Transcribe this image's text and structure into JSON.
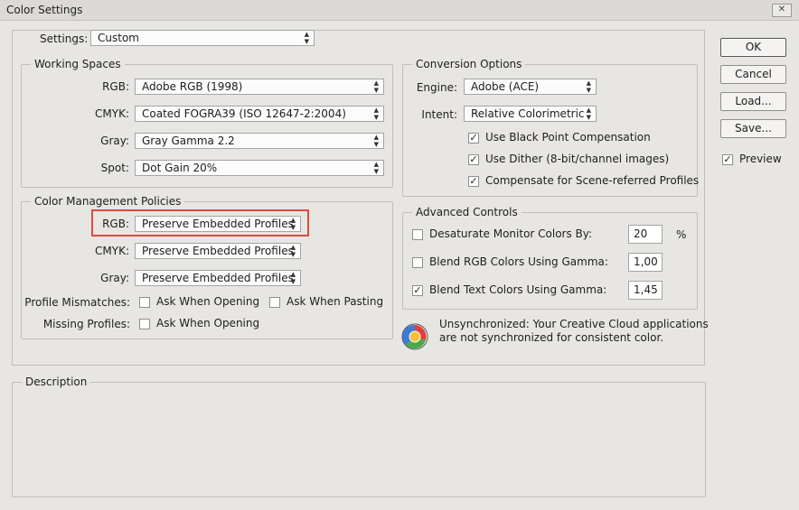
{
  "window": {
    "title": "Color Settings",
    "close_glyph": "✕"
  },
  "settings": {
    "label": "Settings:",
    "value": "Custom"
  },
  "working_spaces": {
    "legend": "Working Spaces",
    "rgb": {
      "label": "RGB:",
      "value": "Adobe RGB (1998)"
    },
    "cmyk": {
      "label": "CMYK:",
      "value": "Coated FOGRA39 (ISO 12647-2:2004)"
    },
    "gray": {
      "label": "Gray:",
      "value": "Gray Gamma 2.2"
    },
    "spot": {
      "label": "Spot:",
      "value": "Dot Gain 20%"
    }
  },
  "policies": {
    "legend": "Color Management Policies",
    "rgb": {
      "label": "RGB:",
      "value": "Preserve Embedded Profiles"
    },
    "cmyk": {
      "label": "CMYK:",
      "value": "Preserve Embedded Profiles"
    },
    "gray": {
      "label": "Gray:",
      "value": "Preserve Embedded Profiles"
    },
    "mismatches_label": "Profile Mismatches:",
    "ask_opening": "Ask When Opening",
    "ask_pasting": "Ask When Pasting",
    "missing_label": "Missing Profiles:",
    "missing_ask_opening": "Ask When Opening"
  },
  "conversion": {
    "legend": "Conversion Options",
    "engine": {
      "label": "Engine:",
      "value": "Adobe (ACE)"
    },
    "intent": {
      "label": "Intent:",
      "value": "Relative Colorimetric"
    },
    "black_point": "Use Black Point Compensation",
    "dither": "Use Dither (8-bit/channel images)",
    "scene": "Compensate for Scene-referred Profiles"
  },
  "advanced": {
    "legend": "Advanced Controls",
    "desaturate": {
      "label": "Desaturate Monitor Colors By:",
      "value": "20",
      "unit": "%"
    },
    "blend_rgb": {
      "label": "Blend RGB Colors Using Gamma:",
      "value": "1,00"
    },
    "blend_text": {
      "label": "Blend Text Colors Using Gamma:",
      "value": "1,45"
    }
  },
  "sync": {
    "line1": "Unsynchronized: Your Creative Cloud applications",
    "line2": "are not synchronized for consistent color."
  },
  "description": {
    "legend": "Description"
  },
  "buttons": {
    "ok": "OK",
    "cancel": "Cancel",
    "load": "Load...",
    "save": "Save..."
  },
  "preview": {
    "label": "Preview"
  },
  "check_glyph": "✓",
  "arrow_glyph": "▲▼",
  "colors": {
    "highlight": "#e04a3a",
    "window_bg": "#e7e6e3"
  }
}
